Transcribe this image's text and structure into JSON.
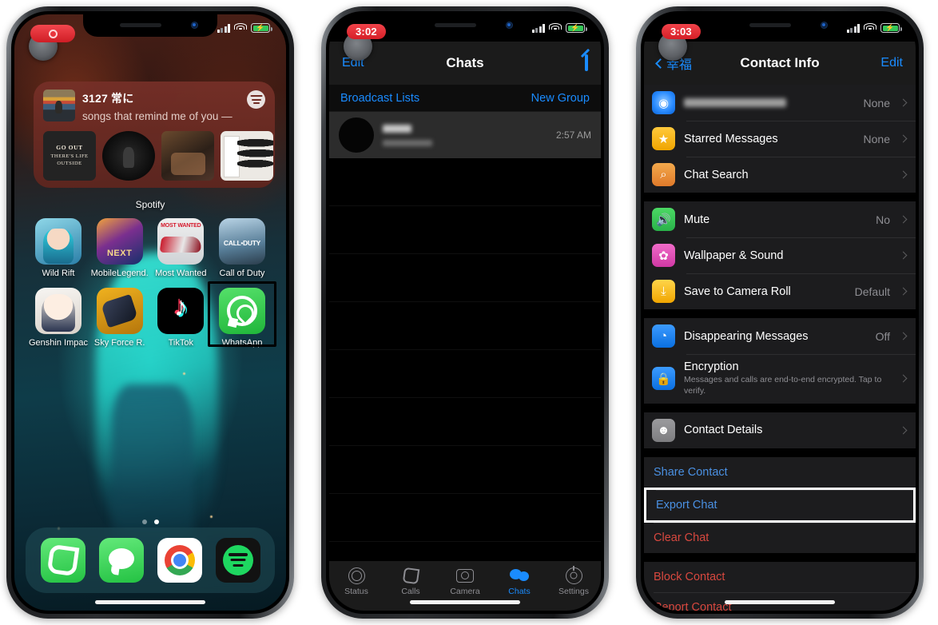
{
  "phone1": {
    "name": "iphone-home-screen",
    "status": {
      "recording_indicator": "rec",
      "signal": "cellular-bars",
      "wifi": "wifi",
      "battery": "battery-charging"
    },
    "widget": {
      "track_title": "3127 常に",
      "subtitle": "songs that remind me of you —",
      "brand": "Spotify",
      "app_label": "Spotify",
      "tiles": [
        {
          "name": "go-out-tile",
          "line1": "GO OUT",
          "line2": "THERE'S LIFE OUTSIDE"
        },
        {
          "name": "concert-tile",
          "line1": "",
          "line2": ""
        },
        {
          "name": "crowd-tile",
          "line1": "",
          "line2": ""
        },
        {
          "name": "leaf-tile",
          "line1": "",
          "line2": ""
        }
      ]
    },
    "apps_row1": [
      {
        "label": "Wild Rift",
        "icon": "wild-rift-icon"
      },
      {
        "label": "MobileLegend.",
        "icon": "mobile-legends-icon"
      },
      {
        "label": "Most Wanted",
        "icon": "need-for-speed-most-wanted-icon"
      },
      {
        "label": "Call of Duty",
        "icon": "call-of-duty-icon"
      }
    ],
    "apps_row2": [
      {
        "label": "Genshin Impact",
        "icon": "genshin-impact-icon"
      },
      {
        "label": "Sky Force R.",
        "icon": "sky-force-reloaded-icon"
      },
      {
        "label": "TikTok",
        "icon": "tiktok-icon"
      },
      {
        "label": "WhatsApp",
        "icon": "whatsapp-icon",
        "highlighted": true
      }
    ],
    "dock": [
      {
        "label": "Phone",
        "icon": "phone-icon"
      },
      {
        "label": "Messages",
        "icon": "messages-icon"
      },
      {
        "label": "Chrome",
        "icon": "chrome-icon"
      },
      {
        "label": "Spotify",
        "icon": "spotify-icon"
      }
    ],
    "page_dots": {
      "count": 2,
      "active_index": 1
    }
  },
  "phone2": {
    "name": "whatsapp-chats-screen",
    "status": {
      "time": "3:02"
    },
    "nav": {
      "left": "Edit",
      "title": "Chats",
      "right_icon": "compose-icon"
    },
    "subbar": {
      "left": "Broadcast Lists",
      "right": "New Group"
    },
    "chat_row": {
      "name_blurred": true,
      "preview_blurred": true,
      "time": "2:57 AM"
    },
    "empty_rows": 8,
    "tabs": [
      {
        "label": "Status",
        "icon": "status-ring-icon",
        "active": false
      },
      {
        "label": "Calls",
        "icon": "phone-handset-icon",
        "active": false
      },
      {
        "label": "Camera",
        "icon": "camera-icon",
        "active": false
      },
      {
        "label": "Chats",
        "icon": "chat-bubbles-icon",
        "active": true
      },
      {
        "label": "Settings",
        "icon": "gear-icon",
        "active": false
      }
    ]
  },
  "phone3": {
    "name": "whatsapp-contact-info-screen",
    "status": {
      "time": "3:03"
    },
    "nav": {
      "back_label": "幸福",
      "title": "Contact Info",
      "right": "Edit"
    },
    "group1": [
      {
        "label": "Media, Links, and Docs",
        "value": "None",
        "icon": "media-icon",
        "blurred": true,
        "chevron": true
      },
      {
        "label": "Starred Messages",
        "value": "None",
        "icon": "star-icon",
        "chevron": true
      },
      {
        "label": "Chat Search",
        "value": "",
        "icon": "search-icon",
        "chevron": true
      }
    ],
    "group2": [
      {
        "label": "Mute",
        "value": "No",
        "icon": "speaker-icon",
        "chevron": true
      },
      {
        "label": "Wallpaper & Sound",
        "value": "",
        "icon": "wallpaper-icon",
        "chevron": true
      },
      {
        "label": "Save to Camera Roll",
        "value": "Default",
        "icon": "save-icon",
        "chevron": true
      }
    ],
    "group3": [
      {
        "label": "Disappearing Messages",
        "value": "Off",
        "icon": "disappearing-icon",
        "chevron": true
      },
      {
        "label": "Encryption",
        "sub": "Messages and calls are end-to-end encrypted. Tap to verify.",
        "value": "",
        "icon": "lock-icon",
        "chevron": true
      }
    ],
    "group4": [
      {
        "label": "Contact Details",
        "value": "",
        "icon": "contact-icon",
        "chevron": true
      }
    ],
    "actions1": [
      {
        "label": "Share Contact",
        "style": "blue"
      },
      {
        "label": "Export Chat",
        "style": "blue",
        "highlighted": true
      },
      {
        "label": "Clear Chat",
        "style": "red"
      }
    ],
    "actions2": [
      {
        "label": "Block Contact",
        "style": "red"
      },
      {
        "label": "Report Contact",
        "style": "red"
      }
    ]
  }
}
